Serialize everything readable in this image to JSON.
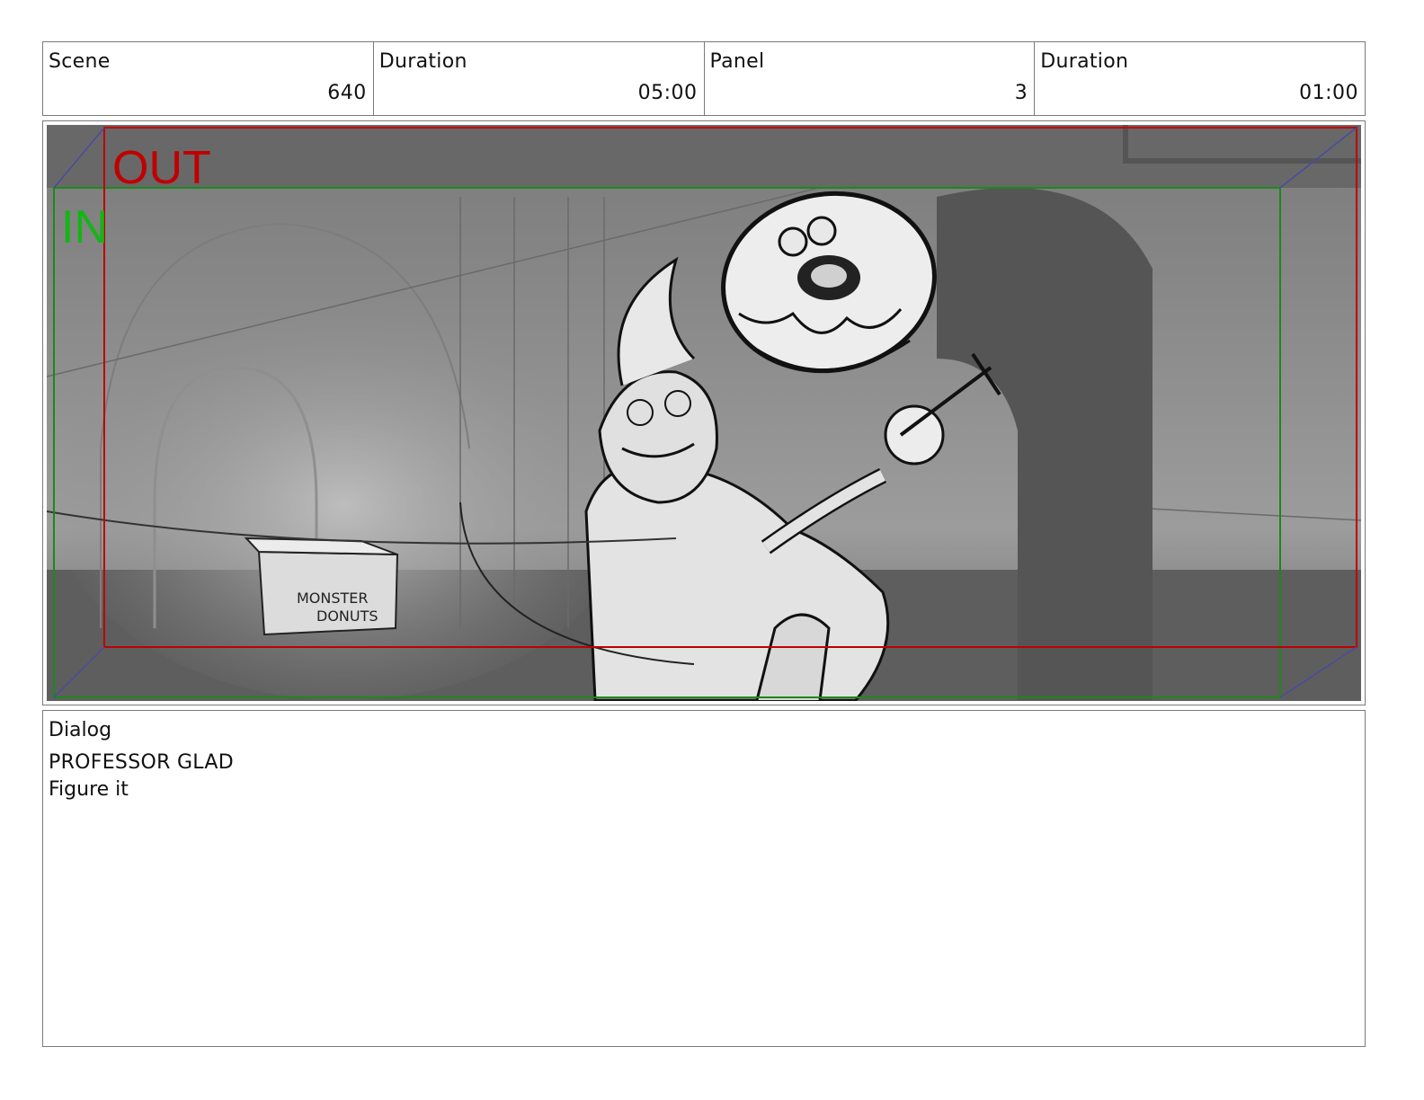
{
  "header": {
    "scene_label": "Scene",
    "scene_value": "640",
    "scene_duration_label": "Duration",
    "scene_duration_value": "05:00",
    "panel_label": "Panel",
    "panel_value": "3",
    "panel_duration_label": "Duration",
    "panel_duration_value": "01:00"
  },
  "panel": {
    "out_label": "OUT",
    "in_label": "IN",
    "box_text_line1": "MONSTER",
    "box_text_line2": "DONUTS",
    "colors": {
      "out_frame": "#c00000",
      "in_frame": "#1a8a1a"
    }
  },
  "dialog": {
    "title": "Dialog",
    "speaker": "PROFESSOR GLAD",
    "line": "Figure it"
  }
}
